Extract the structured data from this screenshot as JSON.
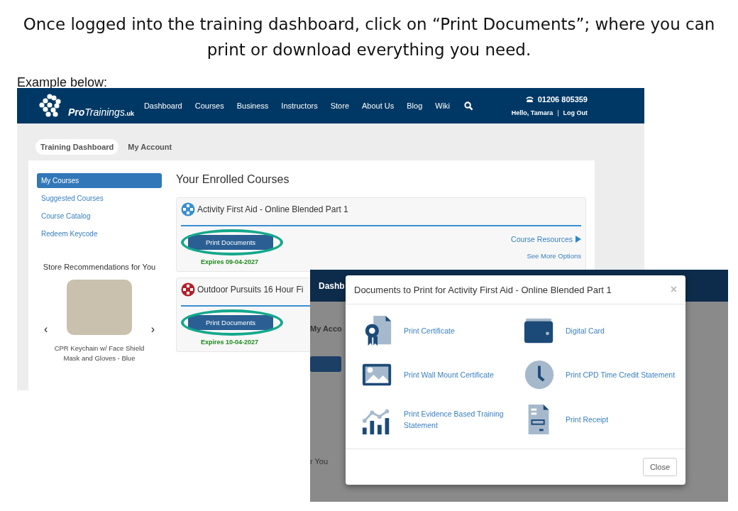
{
  "heading": "Once logged into the training dashboard, click on “Print Documents”; where you can print or download everything you need.",
  "caption": "Example below:",
  "dashboard": {
    "logo": {
      "name": "Pro",
      "name_rest": "Trainings",
      "suffix": ".uk"
    },
    "nav": [
      "Dashboard",
      "Courses",
      "Business",
      "Instructors",
      "Store",
      "About Us",
      "Blog",
      "Wiki"
    ],
    "phone": "01206 805359",
    "greeting": "Hello, Tamara",
    "separator": "|",
    "logout": "Log Out",
    "tabs": [
      {
        "label": "Training Dashboard",
        "selected": true
      },
      {
        "label": "My Account",
        "selected": false
      }
    ],
    "sidebar": {
      "items": [
        {
          "label": "My Courses",
          "selected": true
        },
        {
          "label": "Suggested Courses",
          "selected": false
        },
        {
          "label": "Course Catalog",
          "selected": false
        },
        {
          "label": "Redeem Keycode",
          "selected": false
        }
      ],
      "store_title": "Store Recommendations for You",
      "prev": "‹",
      "next": "›",
      "product": "CPR Keychain w/ Face Shield Mask and Gloves - Blue"
    },
    "title": "Your Enrolled Courses",
    "courses": [
      {
        "title": "Activity First Aid - Online Blended Part 1",
        "color": "#3a8fd0",
        "button": "Print Documents",
        "highlighted": true,
        "expires": "Expires 09-04-2027",
        "resources": "Course Resources",
        "more": "See More Options"
      },
      {
        "title": "Outdoor Pursuits 16 Hour Fi",
        "color": "#b0202a",
        "button": "Print Documents",
        "highlighted": true,
        "expires": "Expires 10-04-2027"
      }
    ]
  },
  "popup_screen": {
    "nav_fragment": "Dashb",
    "tab_fragment": "My Acco",
    "side_fragment": "r You",
    "modal": {
      "title": "Documents to Print for Activity First Aid - Online Blended Part 1",
      "close_mark": "×",
      "items": [
        {
          "kind": "certificate",
          "label": "Print Certificate"
        },
        {
          "kind": "card",
          "label": "Digital Card"
        },
        {
          "kind": "picture",
          "label": "Print Wall Mount Certificate"
        },
        {
          "kind": "clock",
          "label": "Print CPD Time Credit Statement"
        },
        {
          "kind": "chart",
          "label": "Print Evidence Based Training Statement"
        },
        {
          "kind": "receipt",
          "label": "Print Receipt"
        }
      ],
      "close_button": "Close"
    }
  }
}
